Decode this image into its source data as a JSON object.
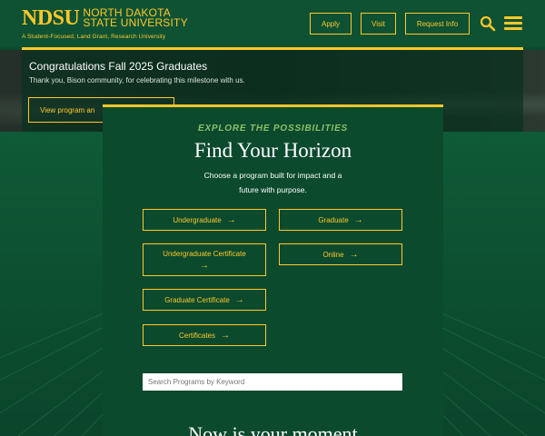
{
  "header": {
    "logo_mark": "NDSU",
    "logo_line1": "NORTH DAKOTA",
    "logo_line2": "STATE UNIVERSITY",
    "tagline": "A Student-Focused, Land Grant, Research University",
    "buttons": {
      "apply": "Apply",
      "visit": "Visit",
      "request_info": "Request Info"
    },
    "icons": {
      "search": "search-icon",
      "menu": "hamburger-menu-icon"
    }
  },
  "hero": {
    "title": "Congratulations Fall 2025 Graduates",
    "subtitle": "Thank you, Bison community, for celebrating this milestone with us.",
    "button_label": "View program an"
  },
  "explore": {
    "eyebrow": "EXPLORE THE POSSIBILITIES",
    "title": "Find Your Horizon",
    "subtitle": "Choose a program built for impact and a future with purpose.",
    "programs": {
      "undergraduate": "Undergraduate",
      "graduate": "Graduate",
      "undergraduate_certificate": "Undergraduate Certificate",
      "online": "Online",
      "graduate_certificate": "Graduate Certificate",
      "certificates": "Certificates"
    },
    "arrow": "→",
    "search_placeholder": "Search Programs by Keyword",
    "search_value": ""
  },
  "moment_heading": "Now is your moment",
  "colors": {
    "brand_green": "#0e5233",
    "brand_gold": "#ffc72a",
    "eyebrow_green": "#8fbf6a"
  }
}
